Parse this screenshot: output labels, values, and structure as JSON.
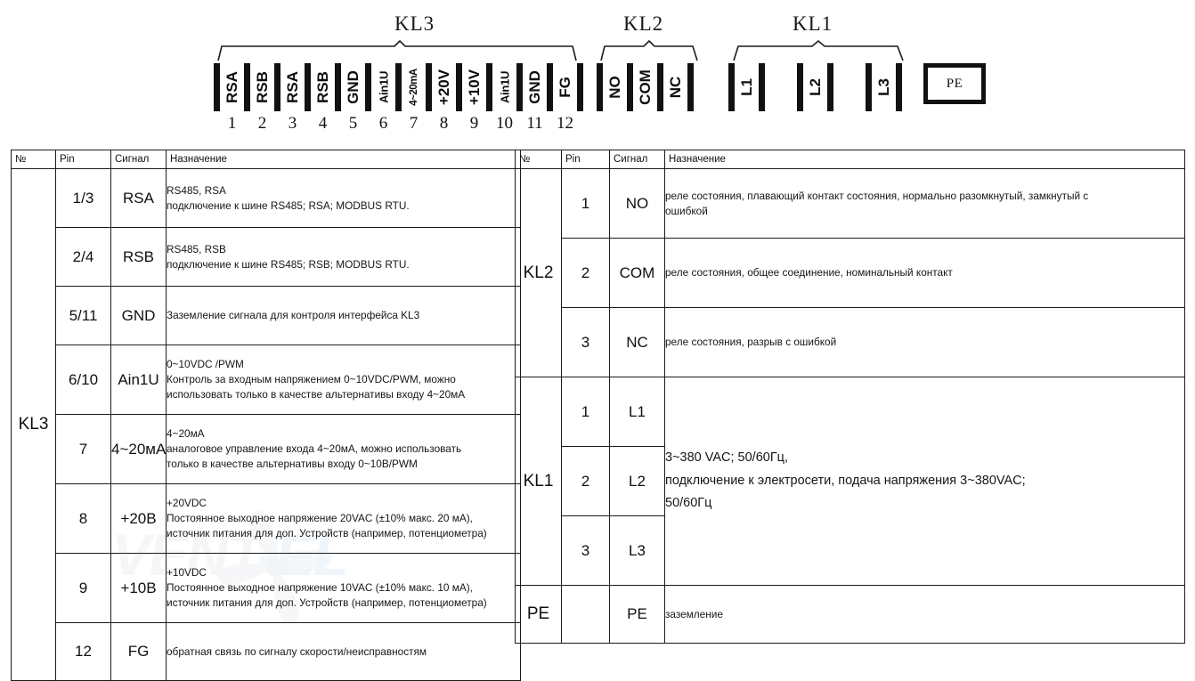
{
  "diagram": {
    "groups": [
      {
        "name": "KL3",
        "label": "KL3"
      },
      {
        "name": "KL2",
        "label": "KL2"
      },
      {
        "name": "KL1",
        "label": "KL1"
      }
    ],
    "kl3_terminals": [
      {
        "label": "RSA",
        "pin": "1",
        "size": "normal"
      },
      {
        "label": "RSB",
        "pin": "2",
        "size": "normal"
      },
      {
        "label": "RSA",
        "pin": "3",
        "size": "normal"
      },
      {
        "label": "RSB",
        "pin": "4",
        "size": "normal"
      },
      {
        "label": "GND",
        "pin": "5",
        "size": "normal"
      },
      {
        "label": "Ain1U",
        "pin": "6",
        "size": "small"
      },
      {
        "label": "4~20mA",
        "pin": "7",
        "size": "tiny"
      },
      {
        "label": "+20V",
        "pin": "8",
        "size": "normal"
      },
      {
        "label": "+10V",
        "pin": "9",
        "size": "normal"
      },
      {
        "label": "Ain1U",
        "pin": "10",
        "size": "small"
      },
      {
        "label": "GND",
        "pin": "11",
        "size": "normal"
      },
      {
        "label": "FG",
        "pin": "12",
        "size": "normal"
      }
    ],
    "kl2_terminals": [
      {
        "label": "NO",
        "size": "normal"
      },
      {
        "label": "COM",
        "size": "normal"
      },
      {
        "label": "NC",
        "size": "normal"
      }
    ],
    "kl1_terminals": [
      {
        "label": "L1",
        "size": "normal"
      },
      {
        "label": "L2",
        "size": "normal"
      },
      {
        "label": "L3",
        "size": "normal"
      }
    ],
    "pe_box_label": "PE"
  },
  "watermark": {
    "text_dark": "VENT",
    "text_light": "-EL"
  },
  "table_left": {
    "headers": {
      "no": "№",
      "pin": "Pin",
      "signal": "Сигнал",
      "purpose": "Назначение"
    },
    "group": "KL3",
    "rows": [
      {
        "pin": "1/3",
        "signal": "RSA",
        "desc_lines": [
          "RS485, RSA",
          "подключение к шине RS485; RSA; MODBUS RTU."
        ]
      },
      {
        "pin": "2/4",
        "signal": "RSB",
        "desc_lines": [
          "RS485, RSB",
          "подключение к шине RS485; RSB; MODBUS RTU."
        ]
      },
      {
        "pin": "5/11",
        "signal": "GND",
        "desc_lines": [
          "Заземление сигнала для контроля интерфейса KL3"
        ]
      },
      {
        "pin": "6/10",
        "signal": "Ain1U",
        "desc_lines": [
          "0~10VDC  /PWM",
          "Контроль за входным напряжением 0~10VDC/PWM, можно",
          "использовать только в качестве альтернативы входу 4~20мА"
        ]
      },
      {
        "pin": "7",
        "signal": "4~20мА",
        "desc_lines": [
          "4~20мА",
          "аналоговое управление входа 4~20мА, можно использовать",
          "только в качестве альтернативы входу 0~10В/PWM"
        ]
      },
      {
        "pin": "8",
        "signal": "+20В",
        "desc_lines": [
          "+20VDC",
          "Постоянное выходное напряжение 20VAC (±10% макс. 20 мА),",
          "источник питания для доп. Устройств (например, потенциометра)"
        ]
      },
      {
        "pin": "9",
        "signal": "+10В",
        "desc_lines": [
          "+10VDC",
          "Постоянное выходное напряжение 10VAC (±10% макс. 10 мА),",
          "источник питания для доп. Устройств (например, потенциометра)"
        ]
      },
      {
        "pin": "12",
        "signal": "FG",
        "desc_lines": [
          "обратная связь по сигналу скорости/неисправностям"
        ]
      }
    ]
  },
  "table_right": {
    "headers": {
      "no": "№",
      "pin": "Pin",
      "signal": "Сигнал",
      "purpose": "Назначение"
    },
    "groups": [
      {
        "name": "KL2",
        "merged_desc": false,
        "rows": [
          {
            "pin": "1",
            "signal": "NO",
            "desc_lines": [
              "реле состояния, плавающий контакт состояния, нормально разомкнутый, замкнутый с",
              "ошибкой"
            ]
          },
          {
            "pin": "2",
            "signal": "COM",
            "desc_lines": [
              "реле состояния, общее соединение, номинальный контакт"
            ]
          },
          {
            "pin": "3",
            "signal": "NC",
            "desc_lines": [
              "реле состояния, разрыв с ошибкой"
            ]
          }
        ]
      },
      {
        "name": "KL1",
        "merged_desc": true,
        "desc_lines": [
          "3~380 VAC; 50/60Гц,",
          "подключение к электросети, подача напряжения 3~380VAC;",
          "50/60Гц"
        ],
        "rows": [
          {
            "pin": "1",
            "signal": "L1"
          },
          {
            "pin": "2",
            "signal": "L2"
          },
          {
            "pin": "3",
            "signal": "L3"
          }
        ]
      },
      {
        "name": "PE",
        "merged_desc": false,
        "rows": [
          {
            "pin": "",
            "signal": "PE",
            "desc_lines": [
              "заземление"
            ]
          }
        ]
      }
    ]
  }
}
